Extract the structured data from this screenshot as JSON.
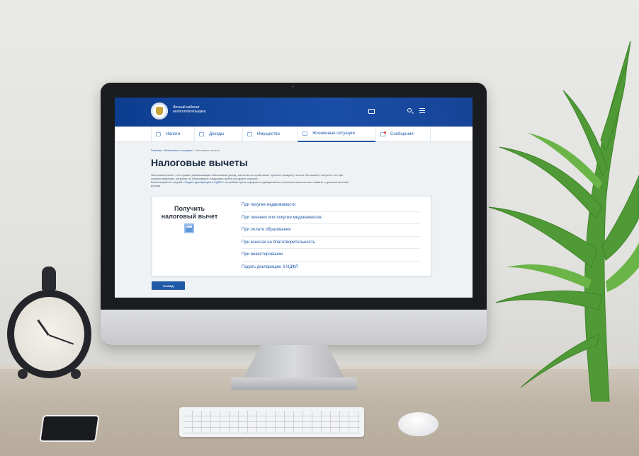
{
  "header": {
    "brand_line1": "Личный кабинет",
    "brand_line2": "налогоплательщика"
  },
  "nav": {
    "items": [
      {
        "label": "Налоги"
      },
      {
        "label": "Доходы"
      },
      {
        "label": "Имущество"
      },
      {
        "label": "Жизненные ситуации"
      },
      {
        "label": "Сообщения"
      }
    ]
  },
  "breadcrumb": {
    "home": "Главная",
    "section": "Жизненные ситуации",
    "current": "Налоговые вычеты",
    "separator": "/"
  },
  "page": {
    "title": "Налоговые вычеты",
    "intro_line1": "Налоговый вычет - это сумма, уменьшающая облагаемый доход, заплатив которой может прийти к возврату налога. Вы можете получить его при",
    "intro_line2": "покупке квартиры, затратах на образование, медицину, детей и в других случаях.",
    "intro_line3_pre": "Воспользуйтесь опцией",
    "intro_line3_link": "«Подать декларацию 3-НДФЛ»",
    "intro_line3_post": ", если Вам нужно оформить одновременно несколько вычетов или заявить о дополнительном",
    "intro_line4": "доходе."
  },
  "card": {
    "heading_line1": "Получить",
    "heading_line2": "налоговый вычет",
    "links": [
      {
        "label": "При покупке недвижимости"
      },
      {
        "label": "При лечении или покупке медикаментов"
      },
      {
        "label": "При оплате образования"
      },
      {
        "label": "При взносах на благотворительность"
      },
      {
        "label": "При инвестировании"
      },
      {
        "label": "Подать декларацию 3-НДФЛ"
      }
    ]
  },
  "back_button": {
    "label": "НАЗАД"
  },
  "icons": {
    "taxes": "document-icon",
    "income": "coins-icon",
    "property": "house-icon",
    "life": "people-icon",
    "messages": "envelope-icon"
  },
  "colors": {
    "header_blue": "#0d3d8f",
    "link_blue": "#1f5aa8",
    "button_blue": "#1f5aa8",
    "notification_red": "#e53935"
  }
}
